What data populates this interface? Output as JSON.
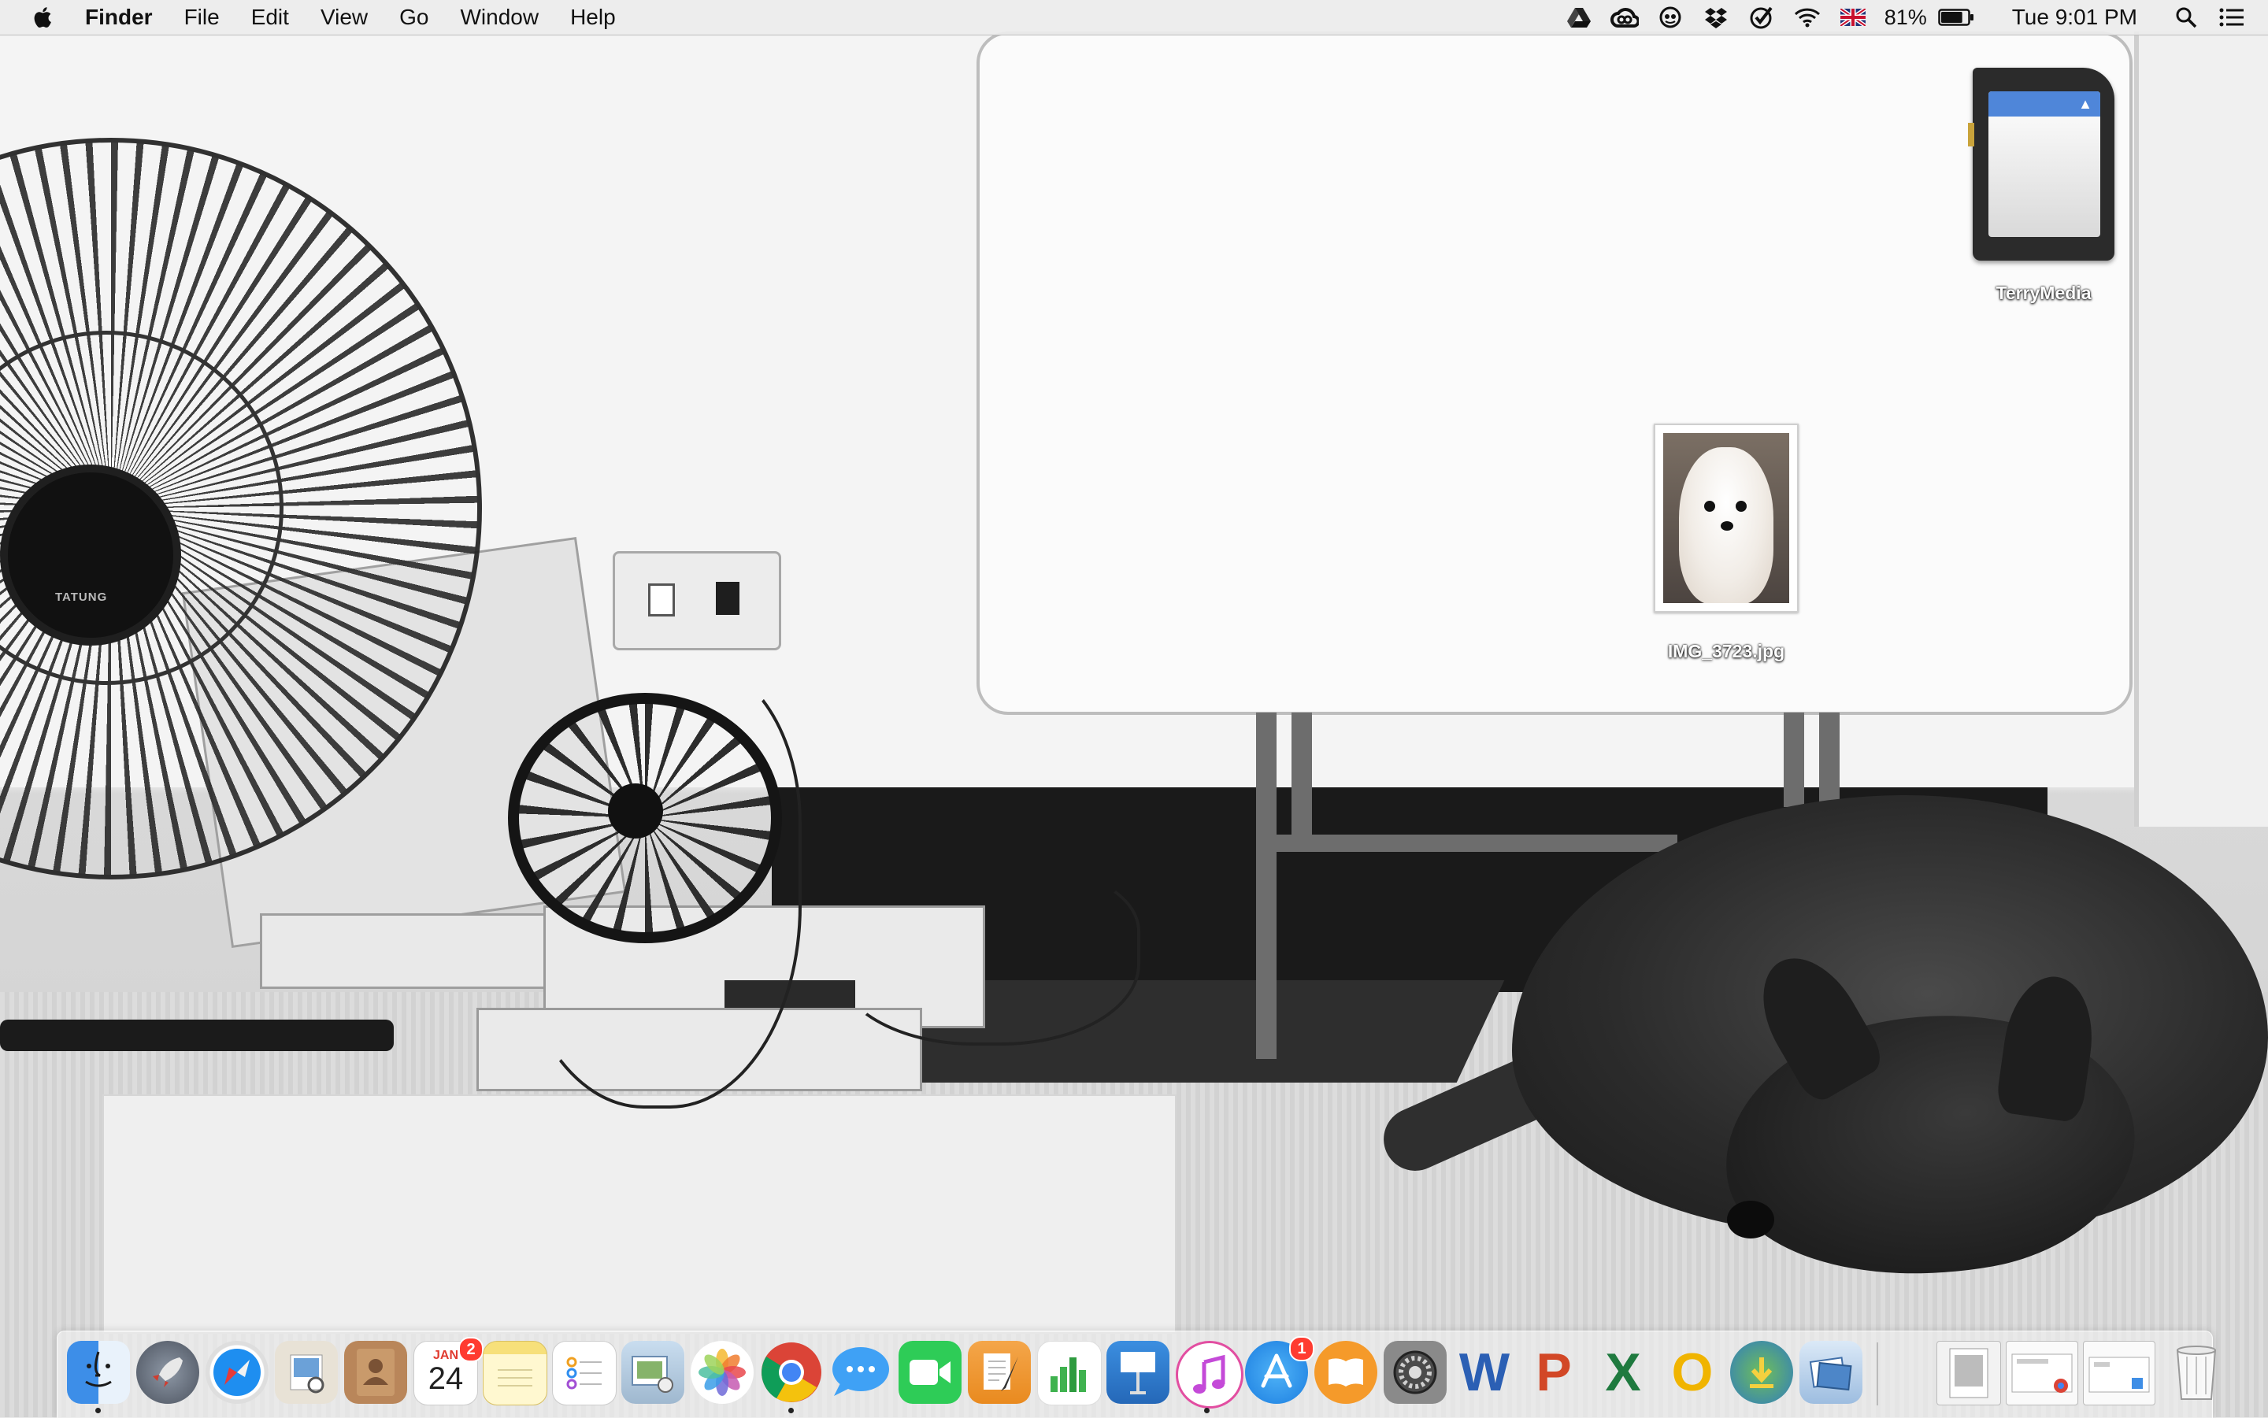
{
  "menubar": {
    "app_name": "Finder",
    "menus": [
      "File",
      "Edit",
      "View",
      "Go",
      "Window",
      "Help"
    ],
    "status": {
      "battery_percent": "81%",
      "clock": "Tue 9:01 PM",
      "battery_level": 0.81
    },
    "status_icons": [
      "google-drive-icon",
      "creative-cloud-icon",
      "eye-icon",
      "dropbox-icon",
      "checkmark-icon",
      "wifi-icon",
      "uk-flag-icon",
      "battery-icon",
      "spotlight-search-icon",
      "notification-center-icon"
    ]
  },
  "desktop": {
    "icons": [
      {
        "label": "TerryMedia",
        "kind": "sd-card-icon"
      },
      {
        "label": "IMG_3723.jpg",
        "kind": "photo-file-icon"
      }
    ]
  },
  "dock": {
    "items": [
      {
        "name": "finder",
        "running": true
      },
      {
        "name": "launchpad"
      },
      {
        "name": "safari"
      },
      {
        "name": "preview"
      },
      {
        "name": "contacts"
      },
      {
        "name": "calendar",
        "month": "JAN",
        "day": "24",
        "badge": "2"
      },
      {
        "name": "notes"
      },
      {
        "name": "reminders"
      },
      {
        "name": "photo-booth"
      },
      {
        "name": "photos"
      },
      {
        "name": "chrome",
        "running": true
      },
      {
        "name": "messages"
      },
      {
        "name": "facetime"
      },
      {
        "name": "pages"
      },
      {
        "name": "numbers"
      },
      {
        "name": "keynote"
      },
      {
        "name": "itunes",
        "running": true
      },
      {
        "name": "app-store",
        "badge": "1"
      },
      {
        "name": "ibooks"
      },
      {
        "name": "system-preferences"
      },
      {
        "name": "word",
        "letter": "W"
      },
      {
        "name": "powerpoint",
        "letter": "P"
      },
      {
        "name": "excel",
        "letter": "X"
      },
      {
        "name": "outlook",
        "letter": "O"
      },
      {
        "name": "downloader"
      },
      {
        "name": "image-capture"
      },
      {
        "name": "stack-1"
      },
      {
        "name": "stack-2"
      },
      {
        "name": "stack-3"
      },
      {
        "name": "trash"
      }
    ],
    "colors": {
      "word": "#2b5fb4",
      "powerpoint": "#d24726",
      "excel": "#1f7a3f",
      "outlook": "#f0b400",
      "badge": "#ff3b30"
    }
  }
}
